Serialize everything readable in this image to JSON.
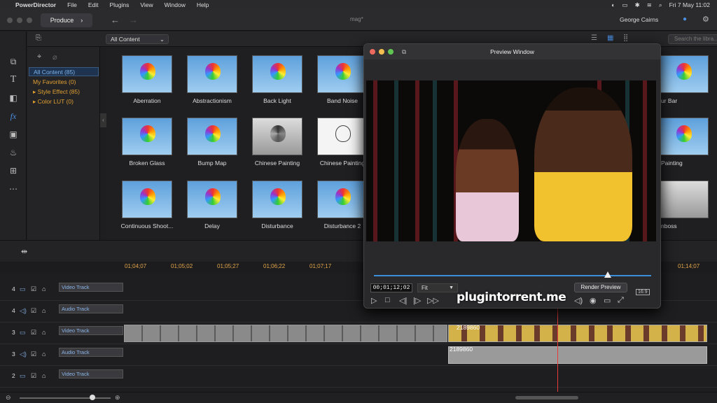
{
  "menubar": {
    "app": "PowerDirector",
    "items": [
      "File",
      "Edit",
      "Plugins",
      "View",
      "Window",
      "Help"
    ],
    "clock": "Fri 7 May  11:02"
  },
  "titlebar": {
    "produce_label": "Produce",
    "project_name": "mag*",
    "user_name": "George Cairns"
  },
  "library": {
    "filter_value": "All Content",
    "search_placeholder": "Search the libra...",
    "categories": [
      {
        "label": "All Content (85)",
        "selected": true
      },
      {
        "label": "My Favorites (0)"
      },
      {
        "label": "▸ Style Effect (85)"
      },
      {
        "label": "▸ Color LUT (0)"
      }
    ],
    "effects": [
      {
        "label": "Aberration",
        "style": "sky"
      },
      {
        "label": "Abstractionism",
        "style": "sky"
      },
      {
        "label": "Back Light",
        "style": "sky"
      },
      {
        "label": "Band Noise",
        "style": "sky"
      },
      {
        "label": "Broken Glass",
        "style": "sky"
      },
      {
        "label": "Bump Map",
        "style": "sky"
      },
      {
        "label": "Chinese Painting",
        "style": "gray"
      },
      {
        "label": "Chinese Painting",
        "style": "sketch"
      },
      {
        "label": "Continuous Shoot...",
        "style": "sky"
      },
      {
        "label": "Delay",
        "style": "sky"
      },
      {
        "label": "Disturbance",
        "style": "sky"
      },
      {
        "label": "Disturbance 2",
        "style": "sky"
      }
    ],
    "right_labels": [
      "ur Bar",
      "Painting",
      "nboss"
    ]
  },
  "preview": {
    "title": "Preview Window",
    "timecode": "00;01;12;02",
    "fit": "Fit",
    "render_label": "Render Preview",
    "aspect": "16:9",
    "position_fraction": 0.86
  },
  "watermark": "plugintorrent.me",
  "timeline": {
    "ruler": [
      "01;04;07",
      "01;05;02",
      "01;05;27",
      "01;06;22",
      "01;07;17",
      "01;14;07"
    ],
    "tracks": [
      {
        "num": "4",
        "label": "Video Track",
        "kind": "video"
      },
      {
        "num": "4",
        "label": "Audio Track",
        "kind": "audio"
      },
      {
        "num": "3",
        "label": "Video Track",
        "kind": "video"
      },
      {
        "num": "3",
        "label": "Audio Track",
        "kind": "audio"
      },
      {
        "num": "2",
        "label": "Video Track",
        "kind": "video"
      }
    ],
    "clip_name": "2189860",
    "clip_name_audio": "2189860"
  }
}
